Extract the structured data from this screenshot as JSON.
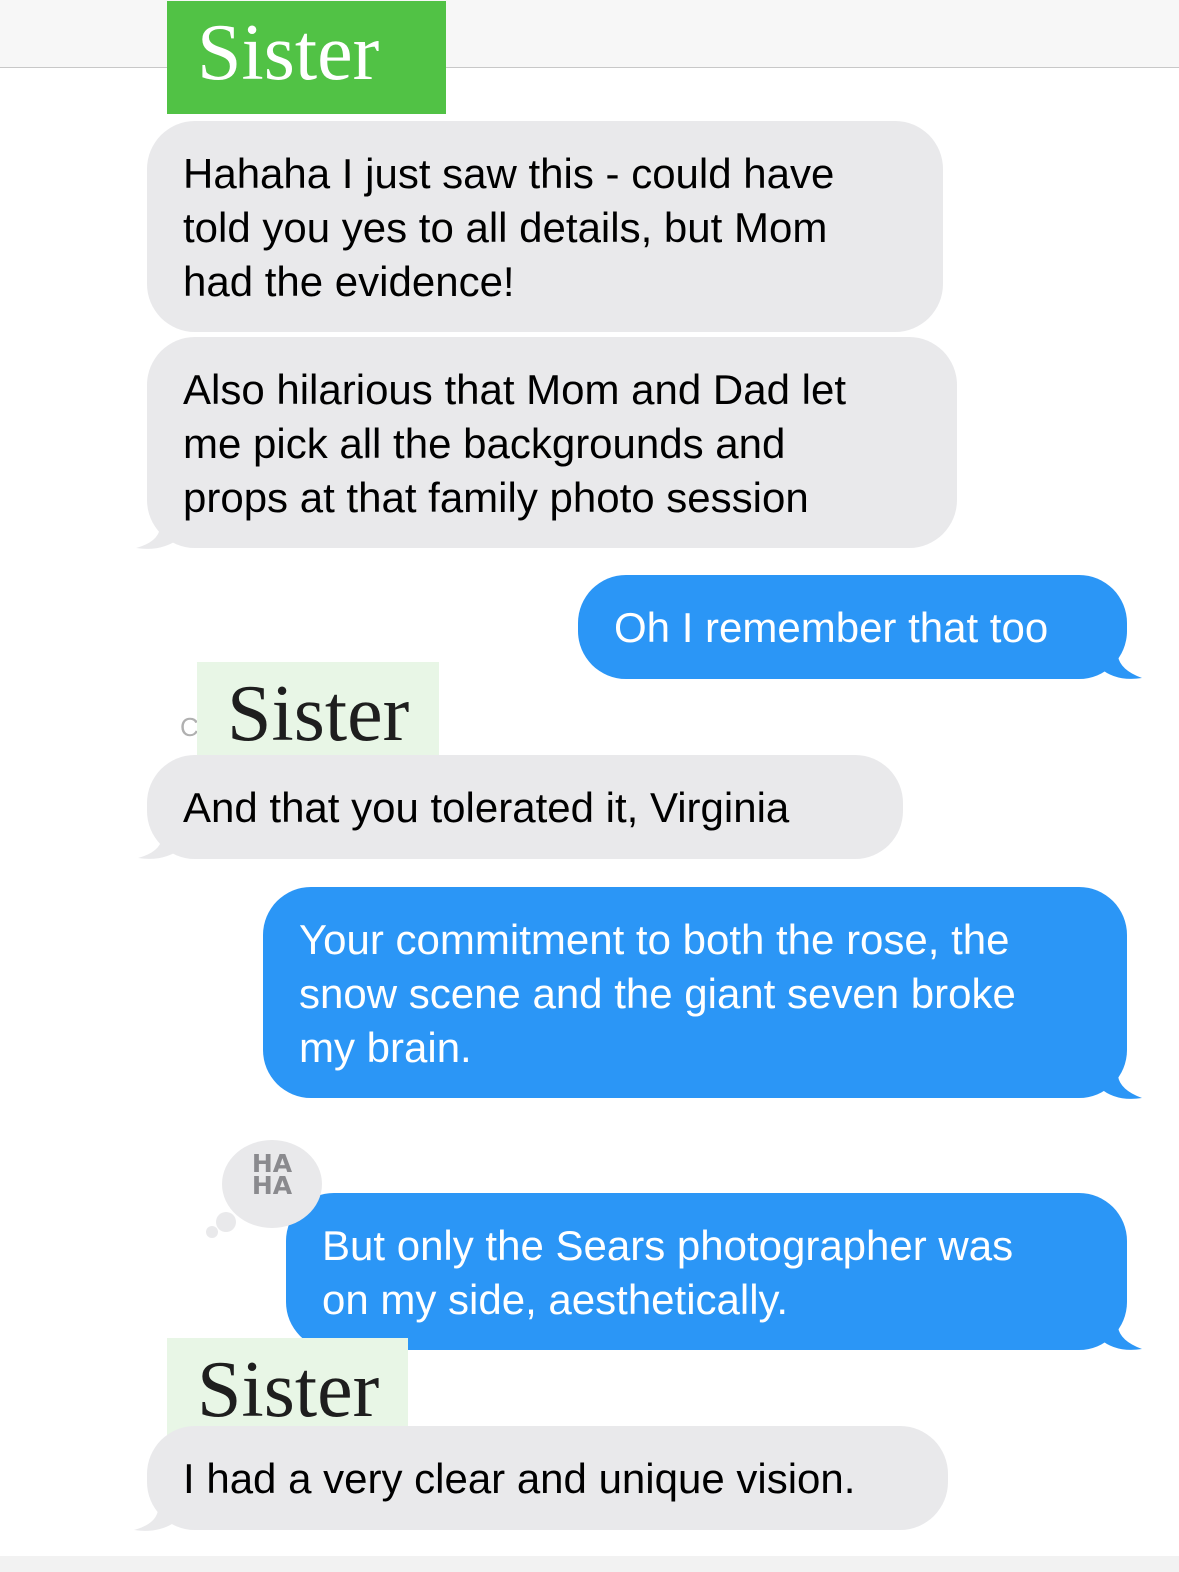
{
  "contact_label": "Sister",
  "colors": {
    "received_bubble": "#e9e9eb",
    "sent_bubble": "#2b96f6",
    "label_green": "#51c245",
    "label_pale_green": "#e8f6e6"
  },
  "messages": [
    {
      "direction": "received",
      "lines": [
        "Hahaha I just saw this - could have",
        "told you yes to all details, but Mom",
        "had the evidence!"
      ]
    },
    {
      "direction": "received",
      "lines": [
        "Also hilarious that Mom and Dad let",
        "me pick all the backgrounds and",
        "props at that family photo session"
      ]
    },
    {
      "direction": "sent",
      "lines": [
        "Oh I remember that too"
      ]
    },
    {
      "direction": "received",
      "lines": [
        "And that you tolerated it, Virginia"
      ]
    },
    {
      "direction": "sent",
      "lines": [
        "Your commitment to both the rose, the",
        "snow scene and the giant seven broke",
        "my brain."
      ]
    },
    {
      "direction": "sent",
      "lines": [
        "But only the Sears photographer was",
        "on my side, aesthetically."
      ],
      "tapback": {
        "icon": "haha-reaction-icon",
        "text": [
          "HA",
          "HA"
        ]
      }
    },
    {
      "direction": "received",
      "lines": [
        "I had a very clear and unique vision."
      ]
    }
  ],
  "ghost_char": "C"
}
